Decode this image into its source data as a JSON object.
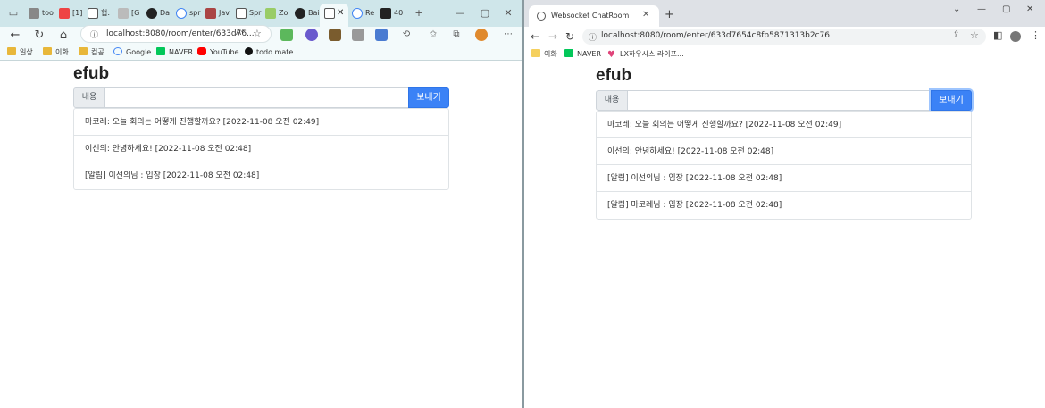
{
  "left_window": {
    "tabs": [
      "too",
      "[1]",
      "협:",
      "[G",
      "Da",
      "spr",
      "Jav",
      "Spr",
      "Zo",
      "Bai",
      "Re",
      "40"
    ],
    "address": {
      "url": "localhost:8080/room/enter/633d76...",
      "read_aloud": "Aᴬ"
    },
    "bookmarks": [
      "일상",
      "이화",
      "컴공",
      "Google",
      "NAVER",
      "YouTube",
      "todo mate"
    ],
    "page": {
      "title": "efub",
      "input_label": "내용",
      "send_label": "보내기",
      "messages": [
        "마코레: 오늘 회의는 어떻게 진행할까요? [2022-11-08 오전 02:49]",
        "이선의: 안녕하세요! [2022-11-08 오전 02:48]",
        "[알림] 이선의님 : 입장 [2022-11-08 오전 02:48]"
      ]
    }
  },
  "right_window": {
    "tab_title": "Websocket ChatRoom",
    "address": {
      "url": "localhost:8080/room/enter/633d7654c8fb5871313b2c76"
    },
    "bookmarks": [
      "이화",
      "NAVER",
      "LX하우시스 라이프..."
    ],
    "page": {
      "title": "efub",
      "input_label": "내용",
      "send_label": "보내기",
      "messages": [
        "마코레: 오늘 회의는 어떻게 진행할까요? [2022-11-08 오전 02:49]",
        "이선의: 안녕하세요! [2022-11-08 오전 02:48]",
        "[알림] 이선의님 : 입장 [2022-11-08 오전 02:48]",
        "[알림] 마코레님 : 입장 [2022-11-08 오전 02:48]"
      ]
    }
  },
  "colors": {
    "edge_frame": "#cfe6ea",
    "chrome_frame": "#dee1e6",
    "send_button": "#3b82f6"
  }
}
